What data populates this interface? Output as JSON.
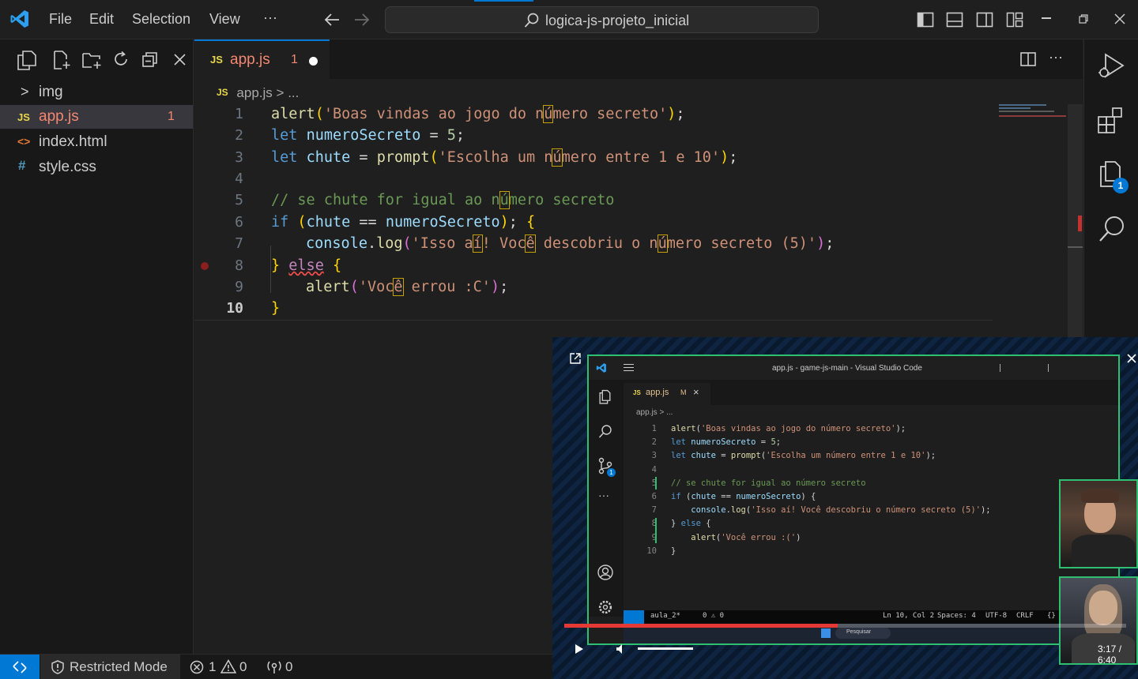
{
  "menu": {
    "file": "File",
    "edit": "Edit",
    "selection": "Selection",
    "view": "View",
    "more": "···"
  },
  "search": {
    "text": "logica-js-projeto_inicial"
  },
  "explorer": {
    "items": [
      {
        "label": "img",
        "icon": ">",
        "badge": ""
      },
      {
        "label": "app.js",
        "icon": "JS",
        "badge": "1"
      },
      {
        "label": "index.html",
        "icon": "<>",
        "badge": ""
      },
      {
        "label": "style.css",
        "icon": "#",
        "badge": ""
      }
    ]
  },
  "tab": {
    "icon": "JS",
    "label": "app.js",
    "badge": "1"
  },
  "breadcrumb": {
    "icon": "JS",
    "file": "app.js",
    "sep": ">",
    "rest": "..."
  },
  "line_numbers": [
    "1",
    "2",
    "3",
    "4",
    "5",
    "6",
    "7",
    "8",
    "9",
    "10"
  ],
  "activity": {
    "badge": "1"
  },
  "status": {
    "restricted": "Restricted Mode",
    "errors": "1",
    "warnings": "0",
    "ports": "0"
  },
  "colors": {
    "accent": "#0078d4",
    "remote_bg": "#0078d4",
    "video_frame": "#2fbf71",
    "progress": "#e53935"
  },
  "video": {
    "title": "app.js - game-js-main - Visual Studio Code",
    "tab_label": "app.js",
    "tab_mark": "M",
    "breadcrumb": "app.js > ...",
    "line_numbers": [
      "1",
      "2",
      "3",
      "4",
      "5",
      "6",
      "7",
      "8",
      "9",
      "10"
    ],
    "status_branch": "aula_2*",
    "status_problems": "0 ⚠ 0",
    "status_pos": "Ln 10, Col 2",
    "status_spaces": "Spaces: 4",
    "status_enc": "UTF-8",
    "status_eol": "CRLF",
    "status_lang": "{} JavaScri",
    "taskbar_search": "Pesquisar",
    "time": "3:17 / 6:40",
    "progress": 0.487
  }
}
